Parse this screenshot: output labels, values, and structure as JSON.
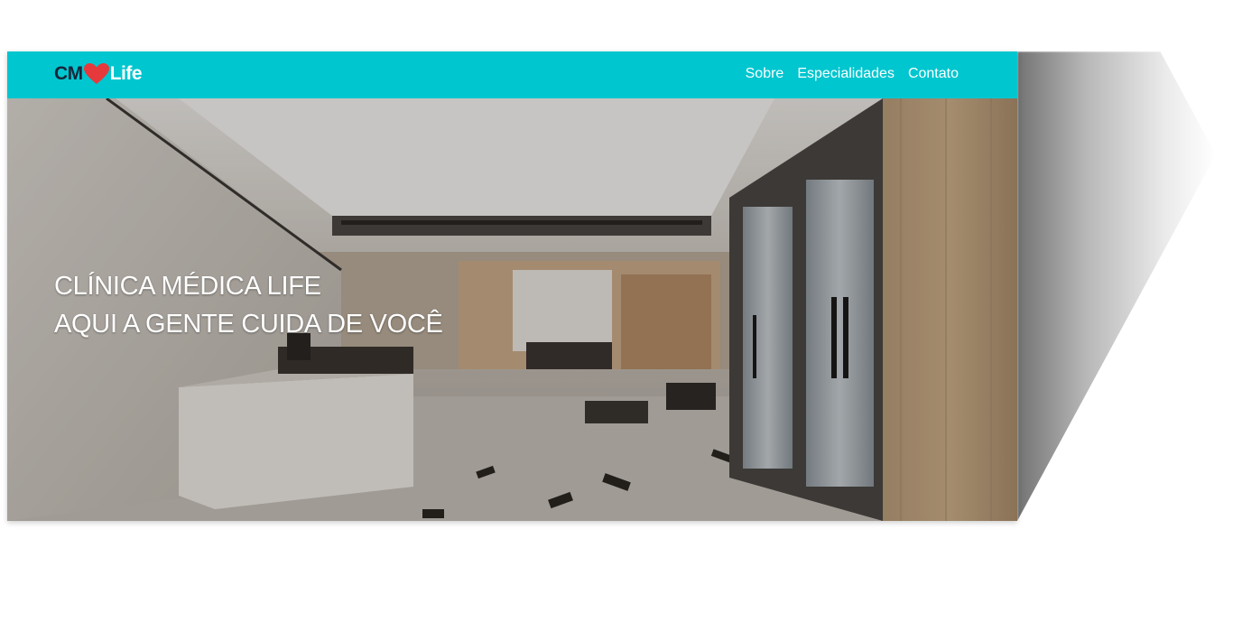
{
  "brand": {
    "prefix": "CM",
    "suffix": "Life",
    "heart_color": "#e5393b",
    "prefix_color": "#17263a"
  },
  "nav": {
    "items": [
      {
        "label": "Sobre"
      },
      {
        "label": "Especialidades"
      },
      {
        "label": "Contato"
      }
    ],
    "bar_color": "#00c6cf"
  },
  "hero": {
    "line1": "CLÍNICA MÉDICA LIFE",
    "line2": "AQUI A GENTE CUIDA DE VOCÊ",
    "image": "clinic-lobby-photo"
  }
}
